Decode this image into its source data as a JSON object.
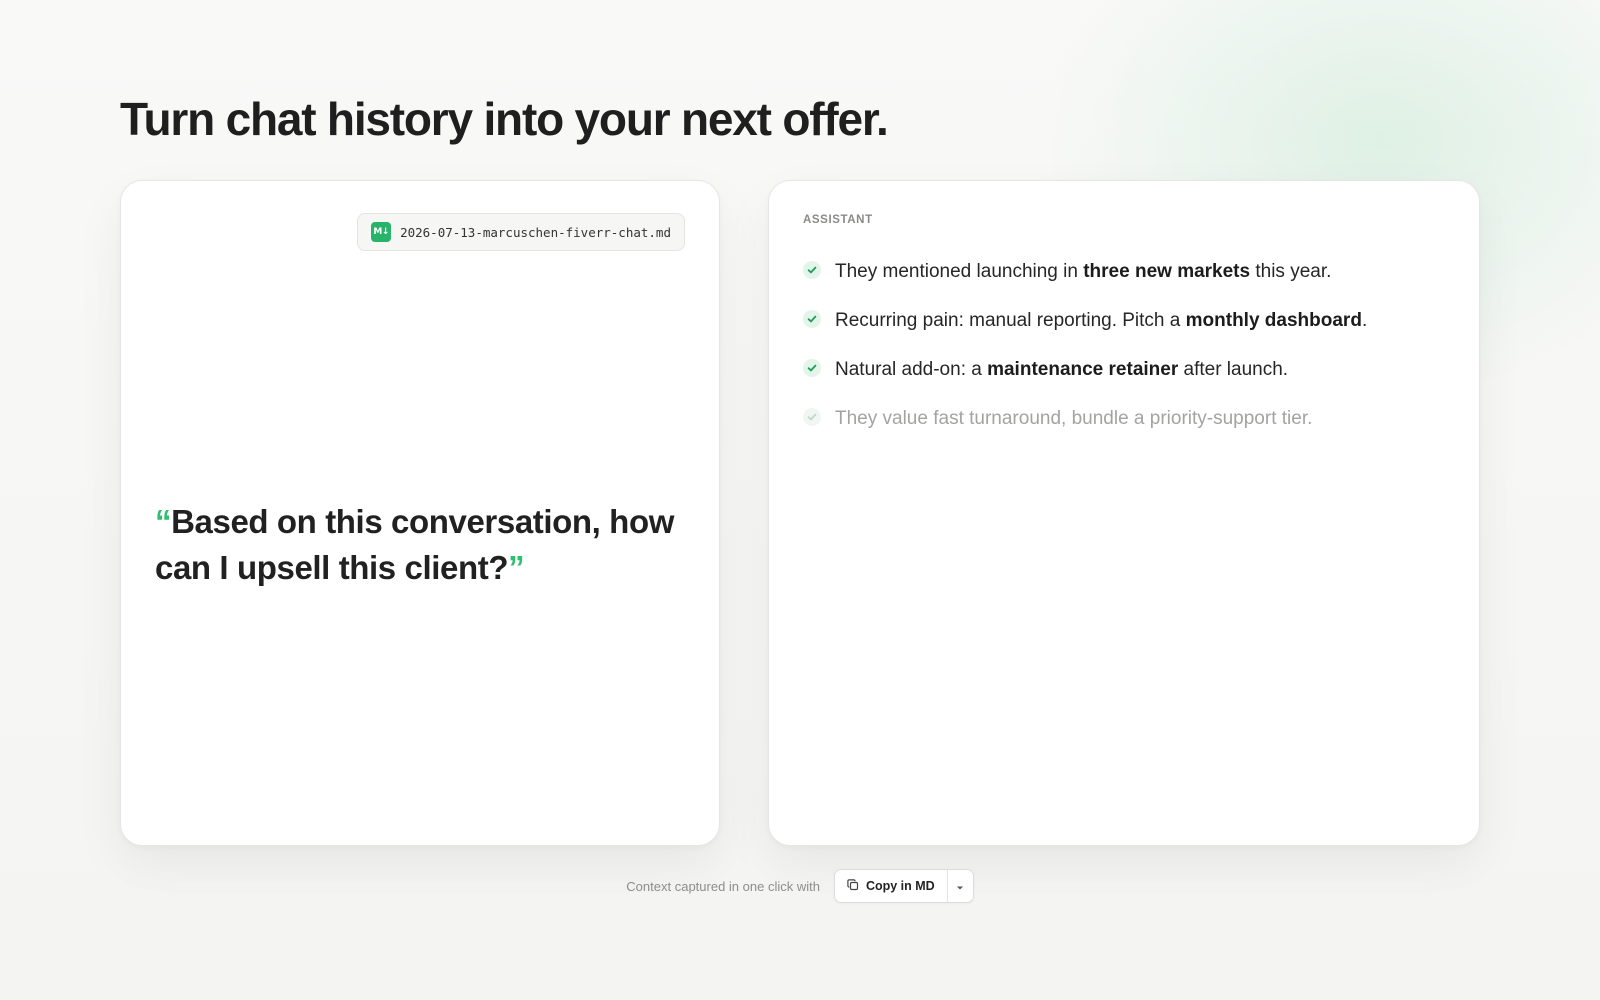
{
  "page": {
    "headline": "Turn chat history into your next offer."
  },
  "prompt_card": {
    "file_badge": "M↓",
    "file_name": "2026-07-13-marcuschen-fiverr-chat.md",
    "quote_open": "“",
    "quote_text": "Based on this conversation, how can I upsell this client?",
    "quote_close": "”"
  },
  "assistant_card": {
    "role_label": "ASSISTANT",
    "insights": [
      {
        "before": "They mentioned launching in ",
        "bold": "three new markets",
        "after": " this year."
      },
      {
        "before": "Recurring pain: manual reporting. Pitch a ",
        "bold": "monthly dashboard",
        "after": "."
      },
      {
        "before": "Natural add-on: a ",
        "bold": "maintenance retainer",
        "after": " after launch."
      },
      {
        "before": "They value fast turnaround, bundle a priority-support tier.",
        "bold": "",
        "after": ""
      }
    ]
  },
  "footer": {
    "caption": "Context captured in one click with",
    "copy_button_label": "Copy in MD"
  },
  "colors": {
    "accent_green": "#2fbf71",
    "text_dark": "#222222",
    "text_muted": "#8d8d8b"
  },
  "icons": {
    "file_badge": "markdown-icon",
    "check": "check-icon",
    "copy": "copy-icon",
    "caret": "chevron-down-icon"
  }
}
